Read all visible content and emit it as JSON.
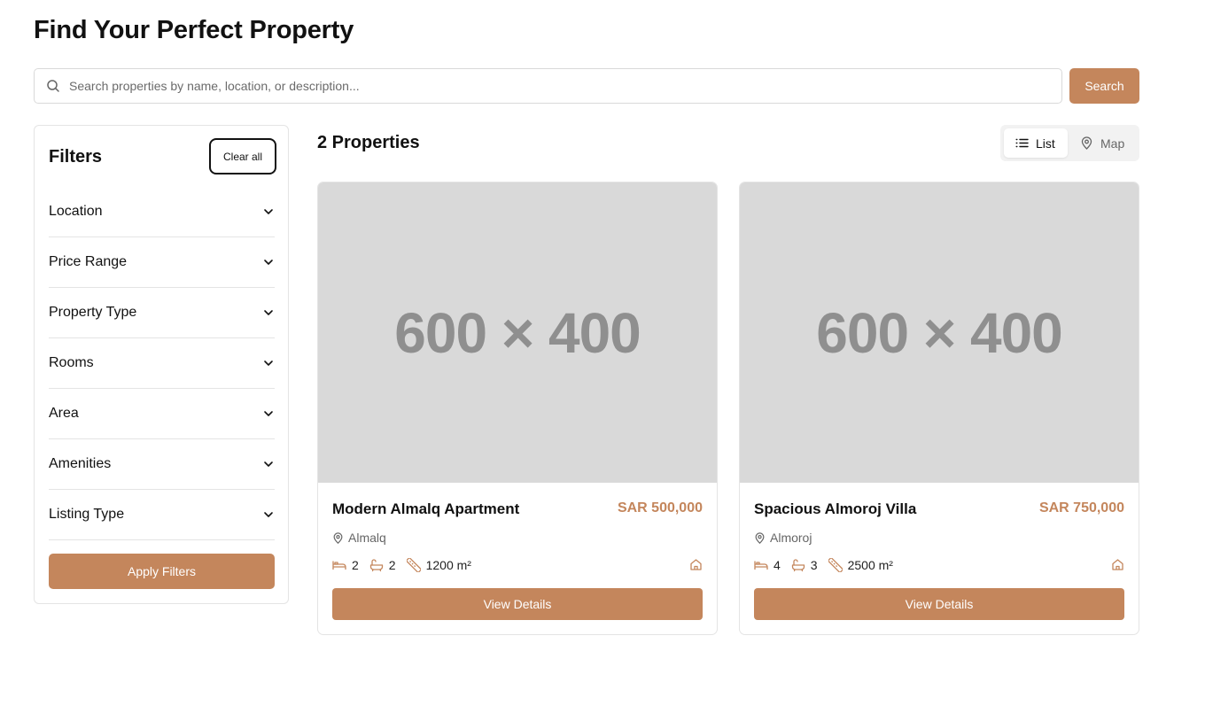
{
  "page": {
    "title": "Find Your Perfect Property"
  },
  "search": {
    "placeholder": "Search properties by name, location, or description...",
    "button_label": "Search",
    "icon": "search-icon"
  },
  "filters": {
    "title": "Filters",
    "clear_label": "Clear all",
    "items": [
      {
        "label": "Location"
      },
      {
        "label": "Price Range"
      },
      {
        "label": "Property Type"
      },
      {
        "label": "Rooms"
      },
      {
        "label": "Area"
      },
      {
        "label": "Amenities"
      },
      {
        "label": "Listing Type"
      }
    ],
    "apply_label": "Apply Filters"
  },
  "results": {
    "count_label": "2 Properties",
    "view_toggle": {
      "list_label": "List",
      "map_label": "Map",
      "active": "List"
    }
  },
  "properties": [
    {
      "image_placeholder": "600 × 400",
      "name": "Modern Almalq Apartment",
      "price": "SAR 500,000",
      "location": "Almalq",
      "bedrooms": "2",
      "bathrooms": "2",
      "area": "1200 m²",
      "details_label": "View Details"
    },
    {
      "image_placeholder": "600 × 400",
      "name": "Spacious Almoroj Villa",
      "price": "SAR 750,000",
      "location": "Almoroj",
      "bedrooms": "4",
      "bathrooms": "3",
      "area": "2500 m²",
      "details_label": "View Details"
    }
  ],
  "colors": {
    "accent": "#c4865c",
    "placeholder_bg": "#d9d9d9",
    "placeholder_text": "#8f8f8f",
    "border": "#e4e4e4"
  }
}
